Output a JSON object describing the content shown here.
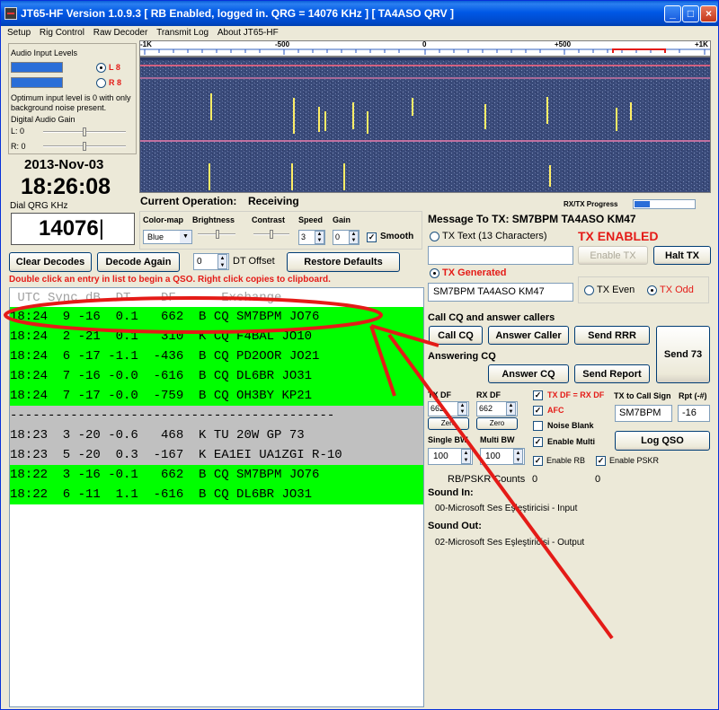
{
  "window": {
    "title": "JT65-HF Version 1.0.9.3  [ RB Enabled, logged in.  QRG = 14076 KHz ] [ TA4ASO QRV ]",
    "controls": {
      "minimize": "_",
      "maximize": "□",
      "close": "×"
    }
  },
  "menu": [
    "Setup",
    "Rig Control",
    "Raw Decoder",
    "Transmit Log",
    "About JT65-HF"
  ],
  "audio": {
    "title": "Audio Input Levels",
    "left_label": "L 8",
    "right_label": "R 8",
    "hint": "Optimum input level is 0 with only background noise present.",
    "gain_title": "Digital Audio Gain",
    "l_gain": "L: 0",
    "r_gain": "R: 0"
  },
  "clock": {
    "date": "2013-Nov-03",
    "time": "18:26:08"
  },
  "qrg": {
    "label": "Dial QRG KHz",
    "value": "14076"
  },
  "waterfall": {
    "scale_labels": [
      "-1K",
      "-500",
      "0",
      "+500",
      "+1K"
    ],
    "progress_label": "RX/TX Progress",
    "progress_fraction": 0.25
  },
  "operation": {
    "label": "Current Operation:",
    "value": "Receiving"
  },
  "display_controls": {
    "colormap_label": "Color-map",
    "colormap_value": "Blue",
    "brightness_label": "Brightness",
    "contrast_label": "Contrast",
    "speed_label": "Speed",
    "speed_value": "3",
    "gain_label": "Gain",
    "gain_value": "0",
    "smooth_label": "Smooth"
  },
  "buttons": {
    "clear_decodes": "Clear Decodes",
    "decode_again": "Decode Again",
    "dt_offset_value": "0",
    "dt_offset_label": "DT Offset",
    "restore_defaults": "Restore Defaults"
  },
  "instructions": "Double click an entry in list to begin a QSO.  Right click copies to clipboard.",
  "decode_header": " UTC Sync dB  DT    DF      Exchange",
  "decodes": [
    {
      "text": "18:24  9 -16  0.1   662  B CQ SM7BPM JO76",
      "style": "green"
    },
    {
      "text": "18:24  2 -21  0.1   310  K CQ F4BAL JO10",
      "style": "green"
    },
    {
      "text": "18:24  6 -17 -1.1  -436  B CQ PD2OOR JO21",
      "style": "green"
    },
    {
      "text": "18:24  7 -16 -0.0  -616  B CQ DL6BR JO31",
      "style": "green"
    },
    {
      "text": "18:24  7 -17 -0.0  -759  B CQ OH3BY KP21",
      "style": "green"
    },
    {
      "text": "-------------------------------------------",
      "style": "gray"
    },
    {
      "text": "18:23  3 -20 -0.6   468  K TU 20W GP 73",
      "style": "gray"
    },
    {
      "text": "18:23  5 -20  0.3  -167  K EA1EI UA1ZGI R-10",
      "style": "gray"
    },
    {
      "text": "18:22  3 -16 -0.1   662  B CQ SM7BPM JO76",
      "style": "green"
    },
    {
      "text": "18:22  6 -11  1.1  -616  B CQ DL6BR JO31",
      "style": "green"
    }
  ],
  "message": {
    "to_tx": "Message To TX: SM7BPM TA4ASO KM47",
    "tx_text_label": "TX Text (13 Characters)",
    "tx_enabled": "TX ENABLED",
    "enable_tx": "Enable TX",
    "halt_tx": "Halt TX",
    "tx_generated_label": "TX Generated",
    "tx_generated_value": "SM7BPM TA4ASO KM47",
    "tx_even": "TX Even",
    "tx_odd": "TX Odd"
  },
  "cq": {
    "title": "Call CQ and answer callers",
    "call_cq": "Call CQ",
    "answer_caller": "Answer Caller",
    "send_rrr": "Send RRR",
    "send_73": "Send 73",
    "answering_title": "Answering CQ",
    "answer_cq": "Answer CQ",
    "send_report": "Send Report"
  },
  "tx_settings": {
    "tx_df_label": "TX DF",
    "tx_df_value": "662",
    "rx_df_label": "RX DF",
    "rx_df_value": "662",
    "zero_label": "Zero",
    "tx_eq_rx": "TX DF = RX DF",
    "afc": "AFC",
    "noise_blank": "Noise Blank",
    "enable_multi": "Enable Multi",
    "enable_rb": "Enable RB",
    "enable_pskr": "Enable PSKR",
    "single_bw_label": "Single BW",
    "single_bw_value": "100",
    "multi_bw_label": "Multi BW",
    "multi_bw_value": "100",
    "tx_call_label": "TX to Call Sign",
    "tx_call_value": "SM7BPM",
    "rpt_label": "Rpt (-#)",
    "rpt_value": "-16",
    "log_qso": "Log QSO"
  },
  "counts": {
    "label": "RB/PSKR Counts",
    "rb": "0",
    "pskr": "0"
  },
  "sound": {
    "in_label": "Sound In:",
    "in_value": "00-Microsoft Ses Eşleştiricisi - Input",
    "out_label": "Sound Out:",
    "out_value": "02-Microsoft Ses Eşleştiricisi - Output"
  },
  "colors": {
    "decode_green": "#00ff00",
    "decode_gray": "#c0c0c0",
    "annotation_red": "#e41b17",
    "waterfall_bg": "#3a4b7a"
  }
}
